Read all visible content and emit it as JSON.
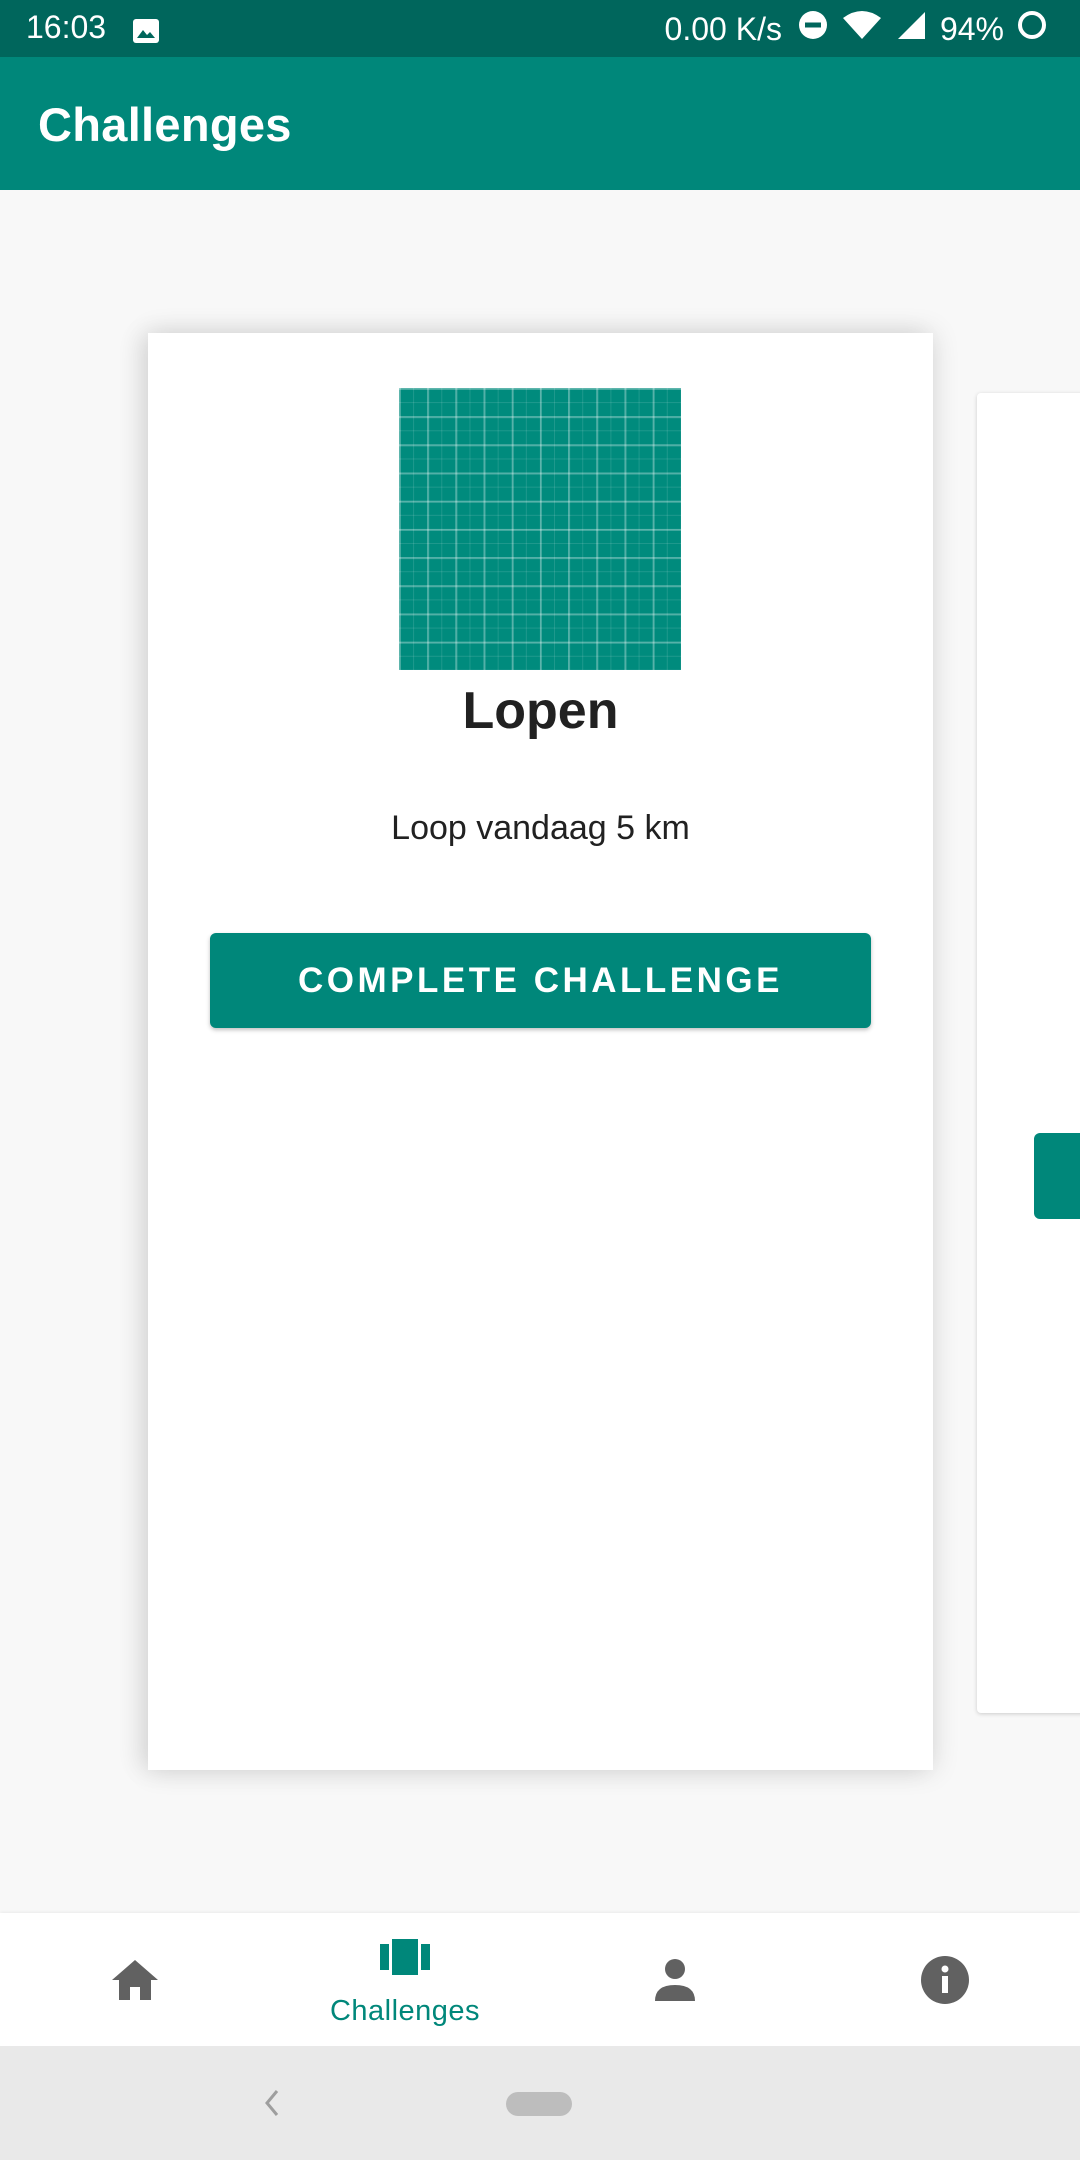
{
  "status_bar": {
    "time": "16:03",
    "network_speed": "0.00 K/s",
    "battery": "94%",
    "icons": [
      "gallery-icon",
      "do-not-disturb-icon",
      "wifi-icon",
      "signal-icon",
      "battery-icon"
    ]
  },
  "app_bar": {
    "title": "Challenges"
  },
  "card": {
    "image_icon": "grid-pattern-image",
    "title": "Lopen",
    "description": "Loop vandaag 5 km",
    "button_label": "COMPLETE CHALLENGE"
  },
  "bottom_nav": {
    "items": [
      {
        "icon": "home-icon",
        "label": ""
      },
      {
        "icon": "carousel-icon",
        "label": "Challenges",
        "selected": true
      },
      {
        "icon": "person-icon",
        "label": ""
      },
      {
        "icon": "info-icon",
        "label": ""
      }
    ]
  },
  "colors": {
    "status_bar": "#00665c",
    "primary": "#00877a",
    "background": "#f8f8f8",
    "inactive_icon": "#616161",
    "system_nav": "#e9e9e9"
  }
}
